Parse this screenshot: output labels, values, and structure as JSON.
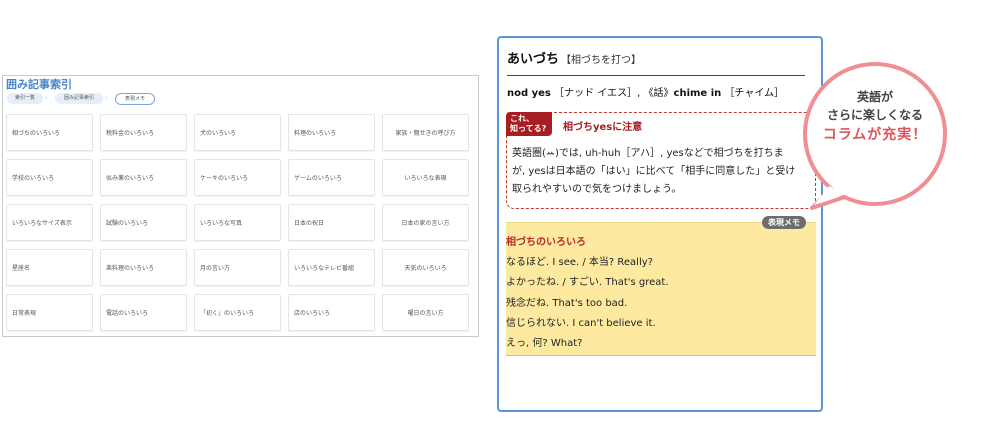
{
  "index_panel": {
    "title": "囲み記事索引",
    "breadcrumbs": [
      "索引一覧",
      "囲み記事索引",
      "表現メモ"
    ],
    "tiles": [
      "相づちのいろいろ",
      "税料金のいろいろ",
      "犬のいろいろ",
      "料理のいろいろ",
      "家族・親せきの呼び方",
      "学校のいろいろ",
      "似み薬のいろいろ",
      "ケーキのいろいろ",
      "ゲームのいろいろ",
      "いろいろな表現",
      "いろいろなサイズ表示",
      "試験のいろいろ",
      "いろいろな写真",
      "日本の祝日",
      "日本の家の言い方",
      "星座名",
      "楽料理のいろいろ",
      "月の言い方",
      "いろいろなテレビ番組",
      "天気のいろいろ",
      "日常表現",
      "電話のいろいろ",
      "「初く」のいろいろ",
      "店のいろいろ",
      "曜日の言い方"
    ]
  },
  "entry": {
    "headword": "あいづち",
    "reading": "【相づちを打つ】",
    "translation_phrase": "nod yes",
    "translation_pron": "［ナッド イエス］,",
    "translation_label": "《話》",
    "translation_phrase2": "chime in",
    "translation_pron2": "［チャイム］",
    "note_tag_line1": "これ、",
    "note_tag_line2": "知ってる?",
    "note_title": "相づちyesに注意",
    "note_lines": [
      "英語圏(ꕀ)では, uh-huh［アハ］, yesなどで相づちを打ちま",
      "が, yesは日本語の「はい」に比べて「相手に同意した」と受け",
      "取られやすいので気をつけましょう。"
    ],
    "memo_badge": "表現メモ",
    "memo_title": "相づちのいろいろ",
    "memo_lines": [
      "なるほど. I see. / 本当? Really?",
      "よかったね. / すごい. That's great.",
      "残念だね. That's too bad.",
      "信じられない. I can't believe it.",
      "えっ, 何? What?"
    ]
  },
  "callout": {
    "line1": "英語が",
    "line2": "さらに楽しくなる",
    "line3": "コラムが充実！",
    "bubble_color": "#ef8f95",
    "accent_color": "#e0525c"
  }
}
